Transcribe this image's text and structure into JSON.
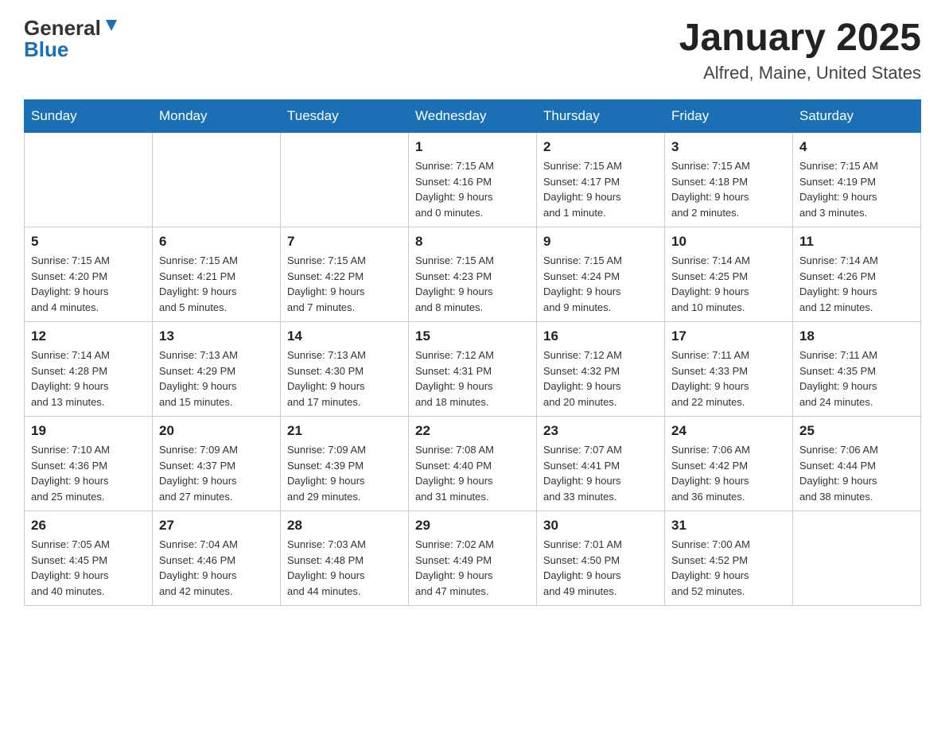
{
  "header": {
    "logo_general": "General",
    "logo_blue": "Blue",
    "month_title": "January 2025",
    "location": "Alfred, Maine, United States"
  },
  "days_of_week": [
    "Sunday",
    "Monday",
    "Tuesday",
    "Wednesday",
    "Thursday",
    "Friday",
    "Saturday"
  ],
  "weeks": [
    [
      {
        "day": "",
        "info": ""
      },
      {
        "day": "",
        "info": ""
      },
      {
        "day": "",
        "info": ""
      },
      {
        "day": "1",
        "info": "Sunrise: 7:15 AM\nSunset: 4:16 PM\nDaylight: 9 hours\nand 0 minutes."
      },
      {
        "day": "2",
        "info": "Sunrise: 7:15 AM\nSunset: 4:17 PM\nDaylight: 9 hours\nand 1 minute."
      },
      {
        "day": "3",
        "info": "Sunrise: 7:15 AM\nSunset: 4:18 PM\nDaylight: 9 hours\nand 2 minutes."
      },
      {
        "day": "4",
        "info": "Sunrise: 7:15 AM\nSunset: 4:19 PM\nDaylight: 9 hours\nand 3 minutes."
      }
    ],
    [
      {
        "day": "5",
        "info": "Sunrise: 7:15 AM\nSunset: 4:20 PM\nDaylight: 9 hours\nand 4 minutes."
      },
      {
        "day": "6",
        "info": "Sunrise: 7:15 AM\nSunset: 4:21 PM\nDaylight: 9 hours\nand 5 minutes."
      },
      {
        "day": "7",
        "info": "Sunrise: 7:15 AM\nSunset: 4:22 PM\nDaylight: 9 hours\nand 7 minutes."
      },
      {
        "day": "8",
        "info": "Sunrise: 7:15 AM\nSunset: 4:23 PM\nDaylight: 9 hours\nand 8 minutes."
      },
      {
        "day": "9",
        "info": "Sunrise: 7:15 AM\nSunset: 4:24 PM\nDaylight: 9 hours\nand 9 minutes."
      },
      {
        "day": "10",
        "info": "Sunrise: 7:14 AM\nSunset: 4:25 PM\nDaylight: 9 hours\nand 10 minutes."
      },
      {
        "day": "11",
        "info": "Sunrise: 7:14 AM\nSunset: 4:26 PM\nDaylight: 9 hours\nand 12 minutes."
      }
    ],
    [
      {
        "day": "12",
        "info": "Sunrise: 7:14 AM\nSunset: 4:28 PM\nDaylight: 9 hours\nand 13 minutes."
      },
      {
        "day": "13",
        "info": "Sunrise: 7:13 AM\nSunset: 4:29 PM\nDaylight: 9 hours\nand 15 minutes."
      },
      {
        "day": "14",
        "info": "Sunrise: 7:13 AM\nSunset: 4:30 PM\nDaylight: 9 hours\nand 17 minutes."
      },
      {
        "day": "15",
        "info": "Sunrise: 7:12 AM\nSunset: 4:31 PM\nDaylight: 9 hours\nand 18 minutes."
      },
      {
        "day": "16",
        "info": "Sunrise: 7:12 AM\nSunset: 4:32 PM\nDaylight: 9 hours\nand 20 minutes."
      },
      {
        "day": "17",
        "info": "Sunrise: 7:11 AM\nSunset: 4:33 PM\nDaylight: 9 hours\nand 22 minutes."
      },
      {
        "day": "18",
        "info": "Sunrise: 7:11 AM\nSunset: 4:35 PM\nDaylight: 9 hours\nand 24 minutes."
      }
    ],
    [
      {
        "day": "19",
        "info": "Sunrise: 7:10 AM\nSunset: 4:36 PM\nDaylight: 9 hours\nand 25 minutes."
      },
      {
        "day": "20",
        "info": "Sunrise: 7:09 AM\nSunset: 4:37 PM\nDaylight: 9 hours\nand 27 minutes."
      },
      {
        "day": "21",
        "info": "Sunrise: 7:09 AM\nSunset: 4:39 PM\nDaylight: 9 hours\nand 29 minutes."
      },
      {
        "day": "22",
        "info": "Sunrise: 7:08 AM\nSunset: 4:40 PM\nDaylight: 9 hours\nand 31 minutes."
      },
      {
        "day": "23",
        "info": "Sunrise: 7:07 AM\nSunset: 4:41 PM\nDaylight: 9 hours\nand 33 minutes."
      },
      {
        "day": "24",
        "info": "Sunrise: 7:06 AM\nSunset: 4:42 PM\nDaylight: 9 hours\nand 36 minutes."
      },
      {
        "day": "25",
        "info": "Sunrise: 7:06 AM\nSunset: 4:44 PM\nDaylight: 9 hours\nand 38 minutes."
      }
    ],
    [
      {
        "day": "26",
        "info": "Sunrise: 7:05 AM\nSunset: 4:45 PM\nDaylight: 9 hours\nand 40 minutes."
      },
      {
        "day": "27",
        "info": "Sunrise: 7:04 AM\nSunset: 4:46 PM\nDaylight: 9 hours\nand 42 minutes."
      },
      {
        "day": "28",
        "info": "Sunrise: 7:03 AM\nSunset: 4:48 PM\nDaylight: 9 hours\nand 44 minutes."
      },
      {
        "day": "29",
        "info": "Sunrise: 7:02 AM\nSunset: 4:49 PM\nDaylight: 9 hours\nand 47 minutes."
      },
      {
        "day": "30",
        "info": "Sunrise: 7:01 AM\nSunset: 4:50 PM\nDaylight: 9 hours\nand 49 minutes."
      },
      {
        "day": "31",
        "info": "Sunrise: 7:00 AM\nSunset: 4:52 PM\nDaylight: 9 hours\nand 52 minutes."
      },
      {
        "day": "",
        "info": ""
      }
    ]
  ]
}
